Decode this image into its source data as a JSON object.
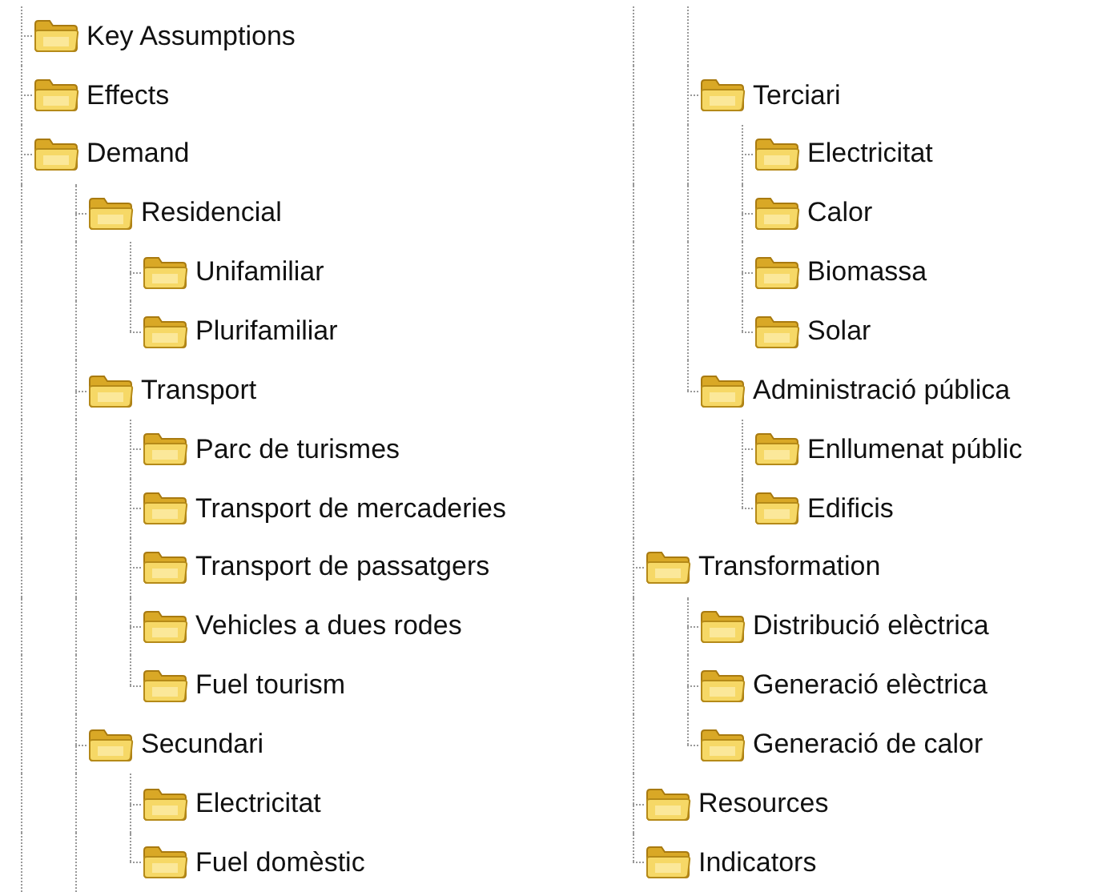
{
  "tree": [
    {
      "label": "Key Assumptions"
    },
    {
      "label": "Effects"
    },
    {
      "label": "Demand",
      "children": [
        {
          "label": "Residencial",
          "children": [
            {
              "label": "Unifamiliar"
            },
            {
              "label": "Plurifamiliar"
            }
          ]
        },
        {
          "label": "Transport",
          "children": [
            {
              "label": "Parc de turismes"
            },
            {
              "label": "Transport de mercaderies"
            },
            {
              "label": "Transport de passatgers"
            },
            {
              "label": "Vehicles a dues rodes"
            },
            {
              "label": "Fuel tourism"
            }
          ]
        },
        {
          "label": "Secundari",
          "children": [
            {
              "label": "Electricitat"
            },
            {
              "label": "Fuel domèstic"
            }
          ]
        },
        {
          "label": "Terciari",
          "children": [
            {
              "label": "Electricitat"
            },
            {
              "label": "Calor"
            },
            {
              "label": "Biomassa"
            },
            {
              "label": "Solar"
            }
          ]
        },
        {
          "label": "Administració pública",
          "children": [
            {
              "label": "Enllumenat públic"
            },
            {
              "label": "Edificis"
            }
          ]
        }
      ]
    },
    {
      "label": "Transformation",
      "children": [
        {
          "label": "Distribució elèctrica"
        },
        {
          "label": "Generació elèctrica"
        },
        {
          "label": "Generació de calor"
        }
      ]
    },
    {
      "label": "Resources"
    },
    {
      "label": "Indicators"
    }
  ]
}
